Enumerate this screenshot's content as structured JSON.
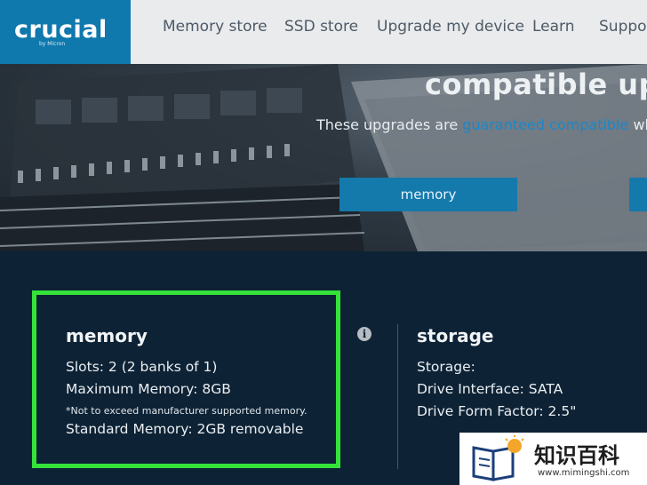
{
  "header": {
    "logo_text": "crucial",
    "logo_tagline": "by Micron",
    "nav": [
      "Memory store",
      "SSD store",
      "Upgrade my device",
      "Learn",
      "Support"
    ]
  },
  "hero": {
    "title": "compatible upg",
    "subtitle_before": "These upgrades are ",
    "subtitle_link": "guaranteed compatible",
    "subtitle_after": " when",
    "buttons": [
      "memory",
      ""
    ]
  },
  "memory": {
    "heading": "memory",
    "slots": "Slots: 2 (2 banks of 1)",
    "max": "Maximum Memory: 8GB",
    "note": "*Not to exceed manufacturer supported memory.",
    "standard": "Standard Memory: 2GB removable"
  },
  "storage": {
    "heading": "storage",
    "storage": "Storage:",
    "interface": "Drive Interface: SATA",
    "form": "Drive Form Factor: 2.5\""
  },
  "info_icon": "info-icon",
  "watermark": {
    "chinese": "知识百科",
    "url": "www.mimingshi.com"
  },
  "colors": {
    "brand_blue": "#0f78ad",
    "highlight_green": "#34e23a",
    "dark_bg": "#0d2235",
    "link_blue": "#1b87c9"
  }
}
